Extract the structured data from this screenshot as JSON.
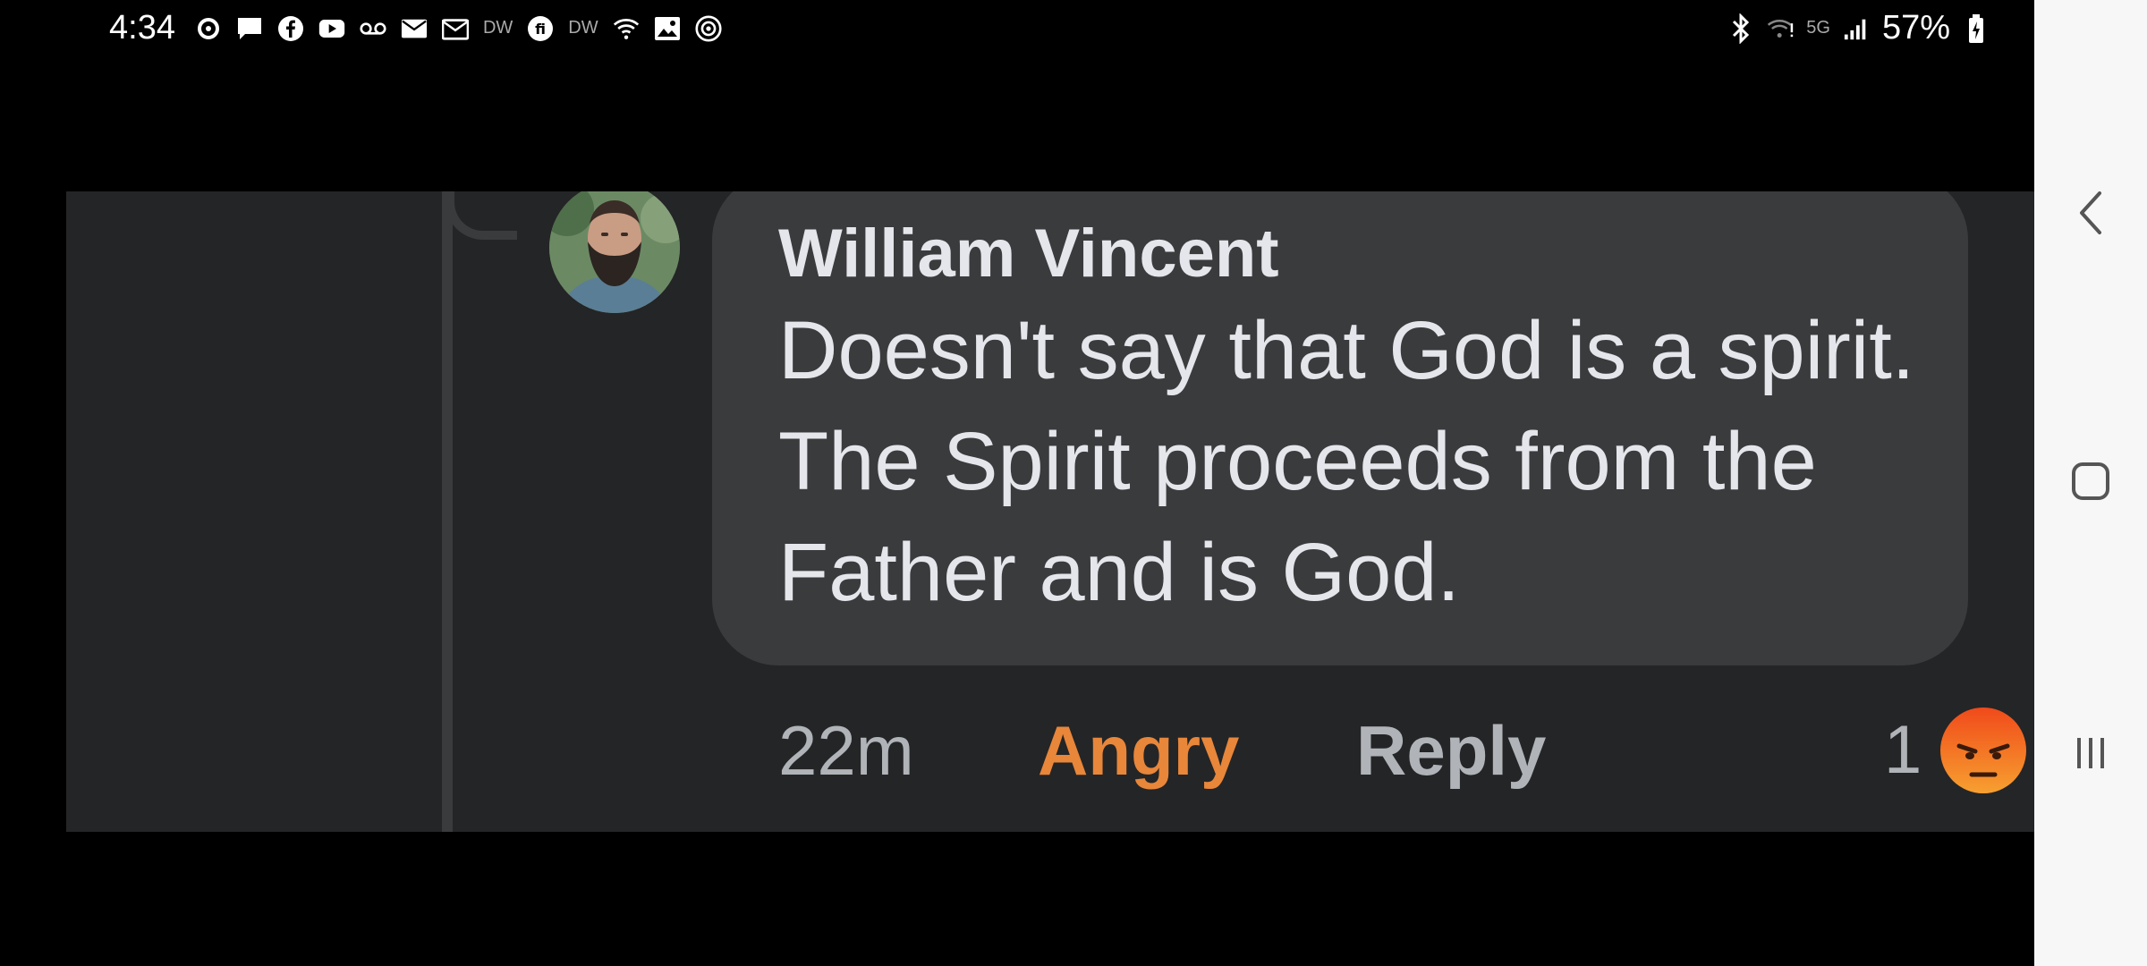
{
  "status_bar": {
    "time": "4:34",
    "left_icons": [
      "sync-icon",
      "message-icon",
      "facebook-icon",
      "youtube-icon",
      "voicemail-icon",
      "mail-icon",
      "mail-icon",
      "dw-icon",
      "fi-icon",
      "dw-icon",
      "wifi-question-icon",
      "image-icon",
      "threads-icon"
    ],
    "dw_label": "DW",
    "network_label": "5G",
    "battery": "57%",
    "right_icons": [
      "bluetooth-icon",
      "wifi-icon",
      "5g-icon",
      "signal-icon",
      "battery-charging-icon"
    ]
  },
  "comment": {
    "author": "William Vincent",
    "text": "Doesn't say that God is a spirit. The Spirit proceeds from the Father and is God.",
    "time": "22m",
    "reaction_label": "Angry",
    "reply_label": "Reply",
    "reaction_count": "1",
    "reaction_emoji": "angry-emoji-icon"
  },
  "colors": {
    "panel_bg": "#242526",
    "bubble_bg": "#3a3b3c",
    "angry_orange": "#e8863a",
    "muted_text": "#b0b3b8"
  },
  "nav": {
    "buttons": [
      "back-icon",
      "home-icon",
      "recents-icon"
    ]
  }
}
